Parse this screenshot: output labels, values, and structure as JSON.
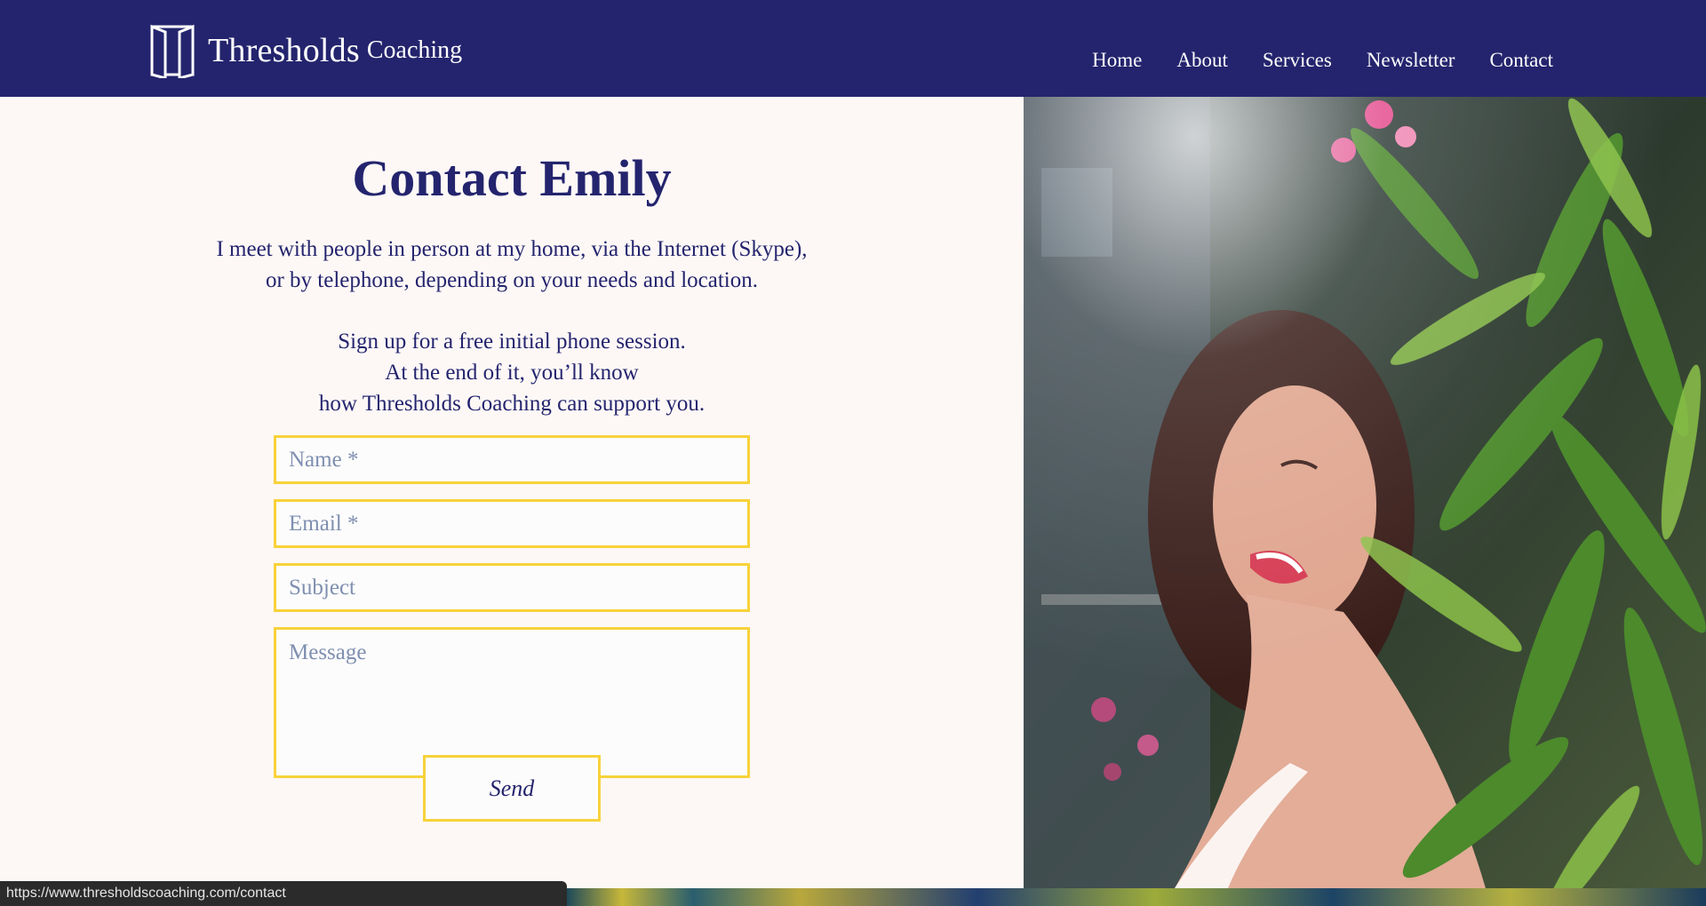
{
  "header": {
    "logo_name": "Thresholds",
    "logo_sub": "Coaching",
    "nav": [
      "Home",
      "About",
      "Services",
      "Newsletter",
      "Contact"
    ]
  },
  "main": {
    "title": "Contact Emily",
    "intro_lines": [
      "I meet with people in person at my home, via the Internet (Skype),",
      "or by telephone, depending on your needs and location."
    ],
    "offer_lines": [
      "Sign up for a free initial phone session.",
      "At the end of it, you’ll know",
      "how Thresholds Coaching can support you."
    ]
  },
  "form": {
    "name_placeholder": "Name *",
    "email_placeholder": "Email *",
    "subject_placeholder": "Subject",
    "message_placeholder": "Message",
    "send_label": "Send"
  },
  "statusbar": {
    "url": "https://www.thresholdscoaching.com/contact"
  },
  "colors": {
    "header_bg": "#24246e",
    "text": "#24246e",
    "field_border": "#f8d23a",
    "page_bg": "#fdf8f6"
  },
  "icons": {
    "logo": "open-door-icon"
  }
}
